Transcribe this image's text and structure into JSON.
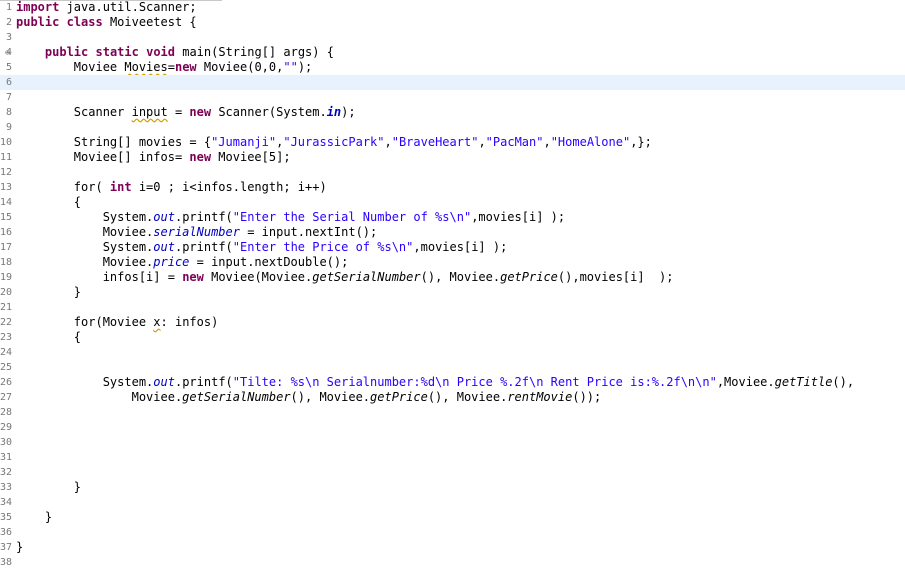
{
  "editor": {
    "line_numbers": [
      "1",
      "2",
      "3",
      "4",
      "5",
      "6",
      "7",
      "8",
      "9",
      "10",
      "11",
      "12",
      "13",
      "14",
      "15",
      "16",
      "17",
      "18",
      "19",
      "20",
      "21",
      "22",
      "23",
      "24",
      "25",
      "26",
      "27",
      "28",
      "29",
      "30",
      "31",
      "32",
      "33",
      "34",
      "35",
      "36",
      "37",
      "38"
    ],
    "fold_icon": "minus-icon",
    "accent_current_line": "#e8f2fe",
    "colors": {
      "keyword": "#7f0055",
      "string": "#2a00ff",
      "field": "#0000c0",
      "warning": "#d4a000"
    }
  },
  "code": {
    "l1_kw": "import",
    "l1_rest": " java.util.Scanner;",
    "l2_kw1": "public",
    "l2_kw2": "class",
    "l2_rest": " Moiveetest {",
    "l4_kw1": "public",
    "l4_kw2": "static",
    "l4_kw3": "void",
    "l4_rest": " main(String[] args) {",
    "l5_a": "Moviee ",
    "l5_warn": "Movies",
    "l5_eq": "=",
    "l5_kw": "new",
    "l5_b": " Moviee(0,0,",
    "l5_str": "\"\"",
    "l5_c": ");",
    "l8_a": "Scanner ",
    "l8_warn": "input",
    "l8_b": " = ",
    "l8_kw": "new",
    "l8_c": " Scanner(System.",
    "l8_sf": "in",
    "l8_d": ");",
    "l10_a": "String[] movies = {",
    "l10_s1": "\"Jumanji\"",
    "l10_s2": "\"JurassicPark\"",
    "l10_s3": "\"BraveHeart\"",
    "l10_s4": "\"PacMan\"",
    "l10_s5": "\"HomeAlone\"",
    "l10_comma": ",",
    "l10_end": ",};",
    "l11_a": "Moviee[] infos= ",
    "l11_kw": "new",
    "l11_b": " Moviee[5];",
    "l13_a": "for( ",
    "l13_kw": "int",
    "l13_b": " i=0 ; i<infos.length; i++)",
    "brace_open": "{",
    "brace_close": "}",
    "sys": "System.",
    "out": "out",
    "printf_open": ".printf(",
    "l15_str": "\"Enter the Serial Number of %s\\n\"",
    "l15_rest": ",movies[i] );",
    "moviee_dot": "Moviee.",
    "l16_fld": "serialNumber",
    "l16_rest": " = input.nextInt();",
    "l17_str": "\"Enter the Price of %s\\n\"",
    "l17_rest": ",movies[i] );",
    "l18_fld": "price",
    "l18_rest": " = input.nextDouble();",
    "l19_a": "infos[i] = ",
    "l19_kw": "new",
    "l19_b": " Moviee(Moviee.",
    "l19_m1": "getSerialNumber",
    "l19_c": "(), Moviee.",
    "l19_m2": "getPrice",
    "l19_d": "(),movies[i]  );",
    "l22_a": "for(Moviee ",
    "l22_warn": "x",
    "l22_b": ": infos)",
    "l26_str": "\"Tilte: %s\\n Serialnumber:%d\\n Price %.2f\\n Rent Price is:%.2f\\n\\n\"",
    "l26_b": ",Moviee.",
    "l26_m": "getTitle",
    "l26_c": "(),",
    "l27_a": "Moviee.",
    "l27_m1": "getSerialNumber",
    "l27_b": "(), Moviee.",
    "l27_m2": "getPrice",
    "l27_c": "(), Moviee.",
    "l27_m3": "rentMovie",
    "l27_d": "());"
  }
}
